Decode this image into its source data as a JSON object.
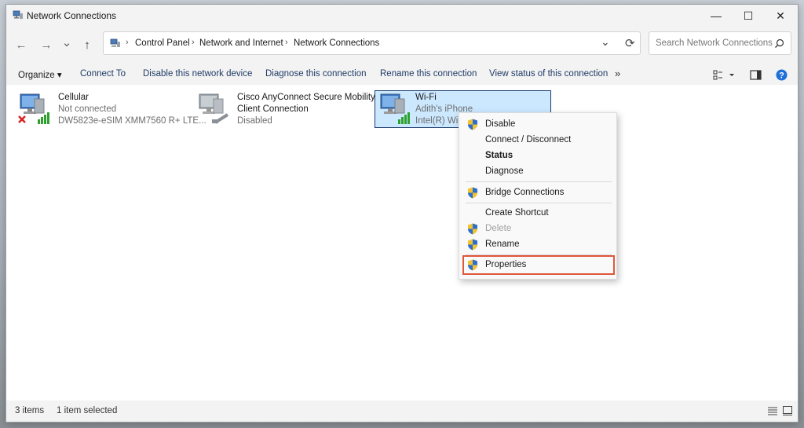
{
  "window": {
    "title": "Network Connections",
    "minimize": "—",
    "maximize": "☐",
    "close": "✕"
  },
  "nav": {
    "back": "←",
    "forward": "→",
    "recent": "⌄",
    "up": "↑",
    "dropdown": "⌄",
    "refresh": "⟳"
  },
  "breadcrumb": [
    "Control Panel",
    "Network and Internet",
    "Network Connections"
  ],
  "search": {
    "placeholder": "Search Network Connections",
    "icon": "search-icon"
  },
  "toolbar": {
    "organize": "Organize ▾",
    "connect_to": "Connect To",
    "disable": "Disable this network device",
    "diagnose": "Diagnose this connection",
    "rename": "Rename this connection",
    "view_status": "View status of this connection",
    "more": "»"
  },
  "items": [
    {
      "name": "Cellular",
      "status": "Not connected",
      "device": "DW5823e-eSIM XMM7560 R+ LTE..."
    },
    {
      "name": "Cisco AnyConnect Secure Mobility",
      "status": "Client Connection",
      "device": "Disabled"
    },
    {
      "name": "Wi-Fi",
      "status": "Adith's iPhone",
      "device": "Intel(R) Wi-F"
    }
  ],
  "context_menu": {
    "disable": "Disable",
    "connect_disconnect": "Connect / Disconnect",
    "status": "Status",
    "diagnose": "Diagnose",
    "bridge": "Bridge Connections",
    "create_shortcut": "Create Shortcut",
    "delete": "Delete",
    "rename": "Rename",
    "properties": "Properties"
  },
  "statusbar": {
    "count": "3 items",
    "selected": "1 item selected"
  },
  "colors": {
    "accent": "#0f6cbd",
    "selection": "#cce8ff",
    "highlight_box": "#e0573a"
  }
}
